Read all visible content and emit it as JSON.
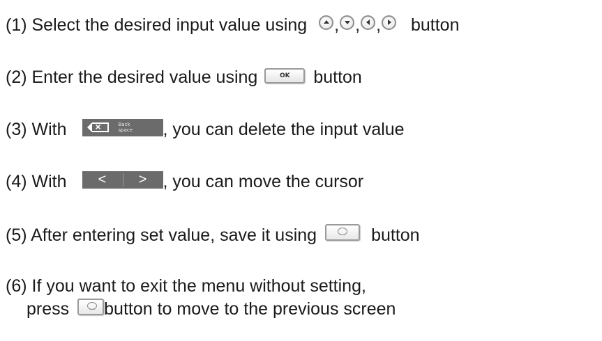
{
  "steps": [
    {
      "before": "(1) Select the desired input value using",
      "after": "button"
    },
    {
      "before": "(2) Enter the desired value using",
      "after": "button"
    },
    {
      "before": "(3) With",
      "after": ", you can delete the input value"
    },
    {
      "before": "(4) With",
      "after": ", you can move the cursor"
    },
    {
      "before": "(5) After entering set value, save it using",
      "after": "button"
    },
    {
      "line1": "(6) If you want to exit the menu without setting,",
      "before": "press",
      "after": "button to move to the previous screen"
    }
  ],
  "icons": {
    "nav": [
      "up-arrow-button-icon",
      "down-arrow-button-icon",
      "left-arrow-button-icon",
      "right-arrow-button-icon"
    ],
    "comma": ",",
    "ok_label": "OK",
    "backspace_label": [
      "Back",
      "space"
    ],
    "cursor_left": "<",
    "cursor_right": ">"
  },
  "colors": {
    "text": "#1a1a1a",
    "dark_key": "#6b6b6b",
    "key_border": "#9a9a9a"
  }
}
